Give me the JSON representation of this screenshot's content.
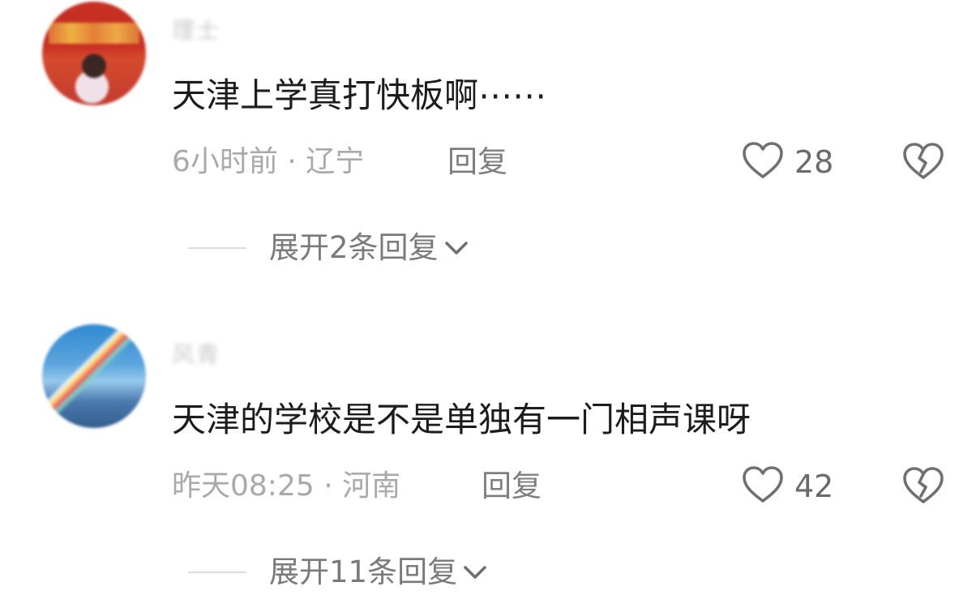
{
  "comments": [
    {
      "username": "理士",
      "text": "天津上学真打快板啊⋯⋯",
      "time": "6小时前",
      "separator": "·",
      "location": "辽宁",
      "reply_label": "回复",
      "likes": "28",
      "expand_label": "展开2条回复"
    },
    {
      "username": "风青",
      "text": "天津的学校是不是单独有一门相声课呀",
      "time": "昨天08:25",
      "separator": "·",
      "location": "河南",
      "reply_label": "回复",
      "likes": "42",
      "expand_label": "展开11条回复"
    }
  ],
  "icons": {
    "like": "heart-outline-icon",
    "dislike": "broken-heart-icon",
    "expand": "chevron-down-icon"
  },
  "colors": {
    "text_primary": "#1c1c1c",
    "text_meta": "#a9a9a9",
    "text_action": "#7e7e7e",
    "icon_stroke": "#707070",
    "divider": "#dcdcdc"
  }
}
